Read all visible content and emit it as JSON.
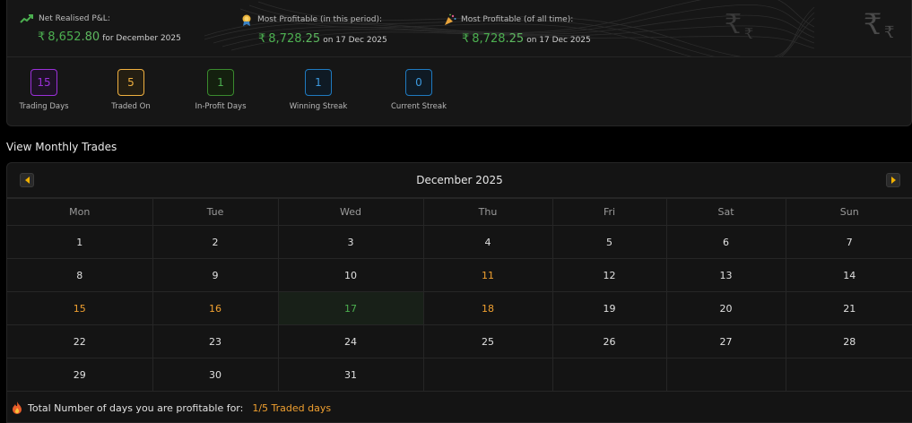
{
  "kpis": {
    "net": {
      "title": "Net Realised P&L:",
      "currency": "₹",
      "int": "8,652",
      "dec": ".80",
      "suffix": "for December 2025"
    },
    "period": {
      "title": "Most Profitable (in this period):",
      "currency": "₹",
      "int": "8,728",
      "dec": ".25",
      "suffix": "on 17 Dec 2025"
    },
    "alltime": {
      "title": "Most Profitable (of all time):",
      "currency": "₹",
      "int": "8,728",
      "dec": ".25",
      "suffix": "on 17 Dec 2025"
    }
  },
  "stats": [
    {
      "value": "15",
      "label": "Trading Days",
      "color": "#9b30d9"
    },
    {
      "value": "5",
      "label": "Traded On",
      "color": "#f0b040"
    },
    {
      "value": "1",
      "label": "In-Profit Days",
      "color": "#3a8a2e"
    },
    {
      "value": "1",
      "label": "Winning Streak",
      "color": "#1f7ac0"
    },
    {
      "value": "0",
      "label": "Current Streak",
      "color": "#1f7ac0"
    }
  ],
  "section_title": "View Monthly Trades",
  "calendar": {
    "month": "December 2025",
    "weekdays": [
      "Mon",
      "Tue",
      "Wed",
      "Thu",
      "Fri",
      "Sat",
      "Sun"
    ],
    "weeks": [
      [
        "1",
        "2",
        "3",
        "4",
        "5",
        "6",
        "7"
      ],
      [
        "8",
        "9",
        "10",
        "11",
        "12",
        "13",
        "14"
      ],
      [
        "15",
        "16",
        "17",
        "18",
        "19",
        "20",
        "21"
      ],
      [
        "22",
        "23",
        "24",
        "25",
        "26",
        "27",
        "28"
      ],
      [
        "29",
        "30",
        "31",
        "",
        "",
        "",
        ""
      ]
    ],
    "traded_days": [
      "11",
      "15",
      "16",
      "18"
    ],
    "profit_days": [
      "17"
    ]
  },
  "footer": {
    "text": "Total Number of days you are profitable for:",
    "highlight": "1/5 Traded days"
  },
  "icons": {
    "net": "trend-up-icon",
    "period": "medal-icon",
    "alltime": "party-popper-icon",
    "footer": "fire-icon"
  },
  "colors": {
    "profit": "#4caf50",
    "traded": "#f0a030",
    "accent": "#f0b000"
  }
}
